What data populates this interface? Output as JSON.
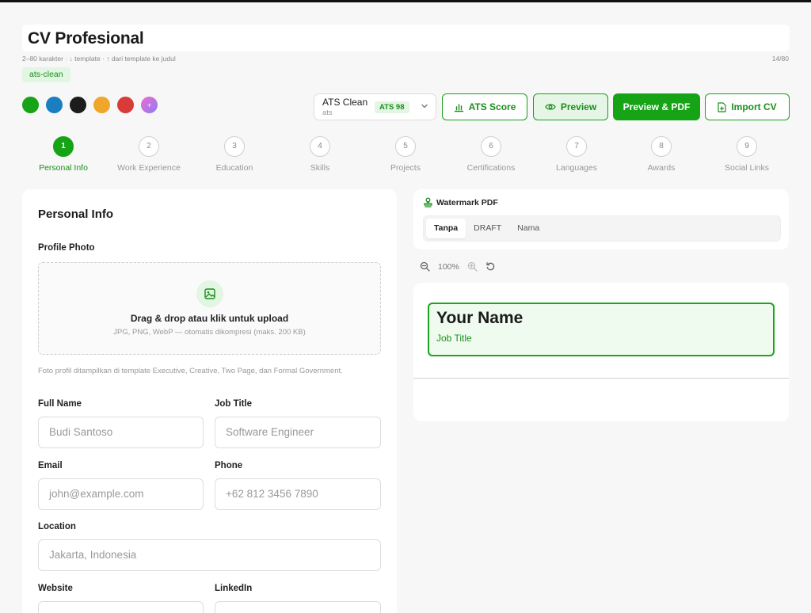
{
  "header": {
    "title": "CV Profesional",
    "hint": "2–80 karakter · ↓ template · ↑ dari template ke judul",
    "counter": "14/80",
    "template_tag": "ats-clean"
  },
  "colors": [
    "#16a316",
    "#1a7fc0",
    "#1c1c1c",
    "#f0a62a",
    "#d93a3a",
    "gradient"
  ],
  "template_select": {
    "name": "ATS Clean",
    "sub": "ats",
    "badge": "ATS 98"
  },
  "toolbar": {
    "ats_score": "ATS Score",
    "preview": "Preview",
    "preview_pdf": "Preview & PDF",
    "import_cv": "Import CV"
  },
  "steps": [
    {
      "num": "1",
      "label": "Personal Info",
      "active": true
    },
    {
      "num": "2",
      "label": "Work Experience"
    },
    {
      "num": "3",
      "label": "Education"
    },
    {
      "num": "4",
      "label": "Skills"
    },
    {
      "num": "5",
      "label": "Projects"
    },
    {
      "num": "6",
      "label": "Certifications"
    },
    {
      "num": "7",
      "label": "Languages"
    },
    {
      "num": "8",
      "label": "Awards"
    },
    {
      "num": "9",
      "label": "Social Links"
    }
  ],
  "form": {
    "title": "Personal Info",
    "profile_photo_label": "Profile Photo",
    "dropzone_title": "Drag & drop atau klik untuk upload",
    "dropzone_sub": "JPG, PNG, WebP — otomatis dikompresi (maks. 200 KB)",
    "photo_note": "Foto profil ditampilkan di template Executive, Creative, Two Page, dan Formal Government.",
    "full_name_label": "Full Name",
    "full_name_placeholder": "Budi Santoso",
    "job_title_label": "Job Title",
    "job_title_placeholder": "Software Engineer",
    "email_label": "Email",
    "email_placeholder": "john@example.com",
    "phone_label": "Phone",
    "phone_placeholder": "+62 812 3456 7890",
    "location_label": "Location",
    "location_placeholder": "Jakarta, Indonesia",
    "website_label": "Website",
    "linkedin_label": "LinkedIn"
  },
  "watermark": {
    "title": "Watermark PDF",
    "tabs": [
      "Tanpa",
      "DRAFT",
      "Nama"
    ]
  },
  "zoom": {
    "level": "100%"
  },
  "preview": {
    "name": "Your Name",
    "job_title": "Job Title"
  }
}
